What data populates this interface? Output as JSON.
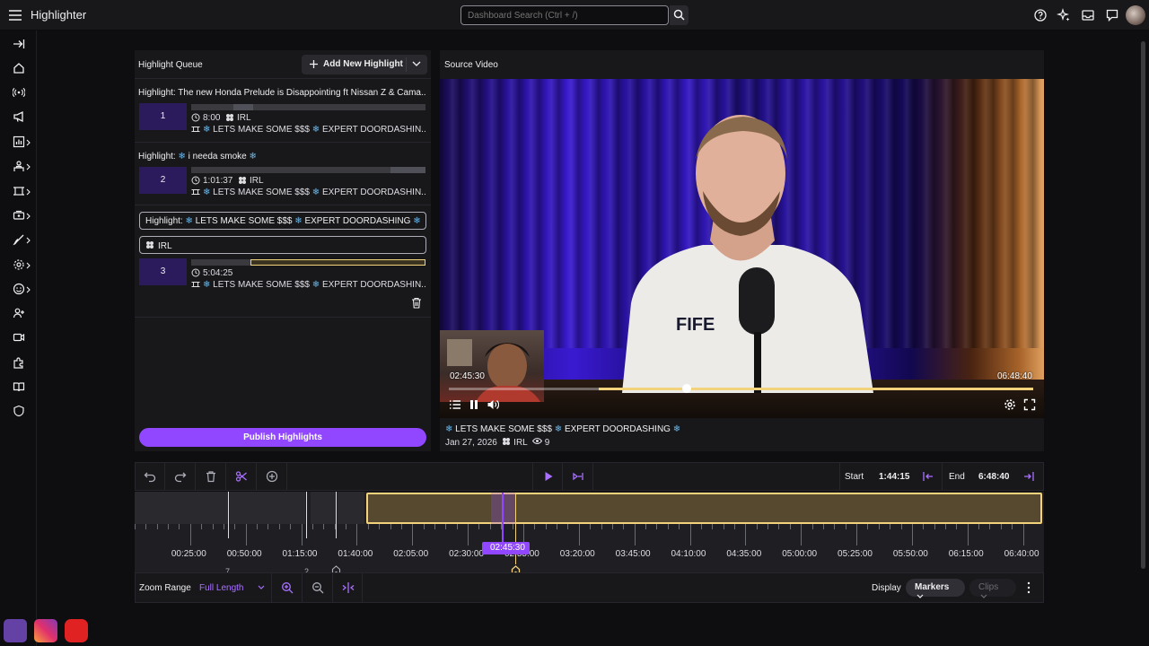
{
  "app": {
    "title": "Highlighter"
  },
  "search": {
    "placeholder": "Dashboard Search (Ctrl + /)"
  },
  "highlight_queue": {
    "title": "Highlight Queue",
    "add_label": "Add New Highlight",
    "items": [
      {
        "number": "1",
        "title": "Highlight: The new Honda Prelude is Disappointing ft Nissan Z & Cama...",
        "time": "8:00",
        "category": "IRL",
        "source": "LETS MAKE SOME $$$",
        "source2": "EXPERT DOORDASHIN..."
      },
      {
        "number": "2",
        "title": "Highlight:",
        "title_rest": "i needa smoke",
        "time": "1:01:37",
        "category": "IRL",
        "source": "LETS MAKE SOME $$$",
        "source2": "EXPERT DOORDASHIN..."
      },
      {
        "number": "3",
        "title": "Highlight:",
        "title_rest": "LETS MAKE SOME $$$",
        "title_rest2": "EXPERT DOORDASHING",
        "category": "IRL",
        "time": "5:04:25",
        "source": "LETS MAKE SOME $$$",
        "source2": "EXPERT DOORDASHIN..."
      }
    ],
    "publish_label": "Publish Highlights"
  },
  "source_video": {
    "title": "Source Video",
    "current_time": "02:45:30",
    "end_time": "06:48:40",
    "stream_title_a": "LETS MAKE SOME $$$",
    "stream_title_b": "EXPERT DOORDASHING",
    "date": "Jan 27, 2026",
    "category": "IRL",
    "views": "9",
    "progress_fraction": 0.405,
    "selection_start_fraction": 0.257
  },
  "timeline": {
    "start_label": "Start",
    "start_value": "1:44:15",
    "end_label": "End",
    "end_value": "6:48:40",
    "ticks": [
      "00:25:00",
      "00:50:00",
      "01:15:00",
      "01:40:00",
      "02:05:00",
      "02:30:00",
      "02:55:00",
      "03:20:00",
      "03:45:00",
      "04:10:00",
      "04:35:00",
      "05:00:00",
      "05:25:00",
      "05:50:00",
      "06:15:00",
      "06:40:00"
    ],
    "playhead": "02:45:30",
    "marker_numbers": [
      "7",
      "2"
    ],
    "zoom_label": "Zoom Range",
    "zoom_value": "Full Length",
    "display_label": "Display",
    "markers_label": "Markers",
    "clips_label": "Clips"
  },
  "colors": {
    "accent": "#9147ff",
    "selection": "#f2d27a",
    "panel": "#18181b",
    "background": "#0e0e10"
  }
}
